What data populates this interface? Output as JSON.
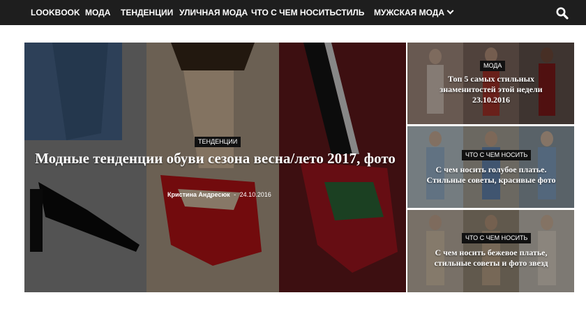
{
  "nav": {
    "items": [
      {
        "label": "LOOKBOOK"
      },
      {
        "label": "МОДА"
      },
      {
        "label": "ТЕНДЕНЦИИ"
      },
      {
        "label": "УЛИЧНАЯ МОДА"
      },
      {
        "label": "ЧТО С ЧЕМ НОСИТЬ"
      },
      {
        "label": "СТИЛЬ"
      },
      {
        "label": "МУЖСКАЯ МОДА"
      }
    ],
    "search_icon": "search-icon",
    "dropdown_icon": "chevron-down-icon"
  },
  "main": {
    "category": "ТЕНДЕНЦИИ",
    "title": "Модные тенденции обуви сезона весна/лето 2017, фото",
    "author": "Кристина Андресюк",
    "separator": "-",
    "date": "24.10.2016"
  },
  "side": [
    {
      "category": "МОДА",
      "title": "Топ 5 самых стильных знаменитостей этой недели 23.10.2016"
    },
    {
      "category": "ЧТО С ЧЕМ НОСИТЬ",
      "title": "С чем носить голубое платье. Стильные советы, красивые фото"
    },
    {
      "category": "ЧТО С ЧЕМ НОСИТЬ",
      "title": "С чем носить бежевое платье, стильные советы и фото звезд"
    }
  ],
  "colors": {
    "nav_bg": "#1e1e1e",
    "badge_bg": "#111111",
    "text": "#ffffff"
  }
}
